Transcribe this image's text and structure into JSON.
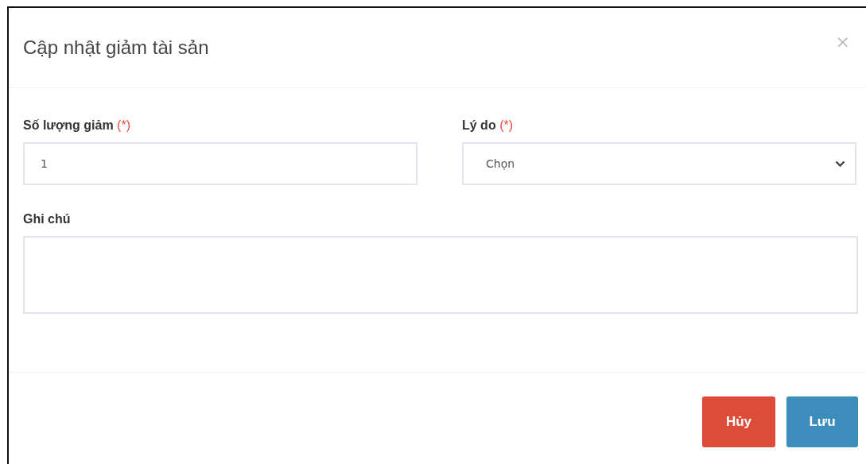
{
  "dialog": {
    "title": "Cập nhật giảm tài sản",
    "close": "×"
  },
  "fields": [
    {
      "kind": "input",
      "label": "Số lượng giảm",
      "required_mark": "(*)",
      "value": "1"
    },
    {
      "kind": "select",
      "label": "Lý do",
      "required_mark": "(*)",
      "value": "Chọn"
    }
  ],
  "note": {
    "label": "Ghi chú"
  },
  "buttons": [
    {
      "label": "Hủy",
      "kind": "danger"
    },
    {
      "label": "Lưu",
      "kind": "primary"
    }
  ]
}
